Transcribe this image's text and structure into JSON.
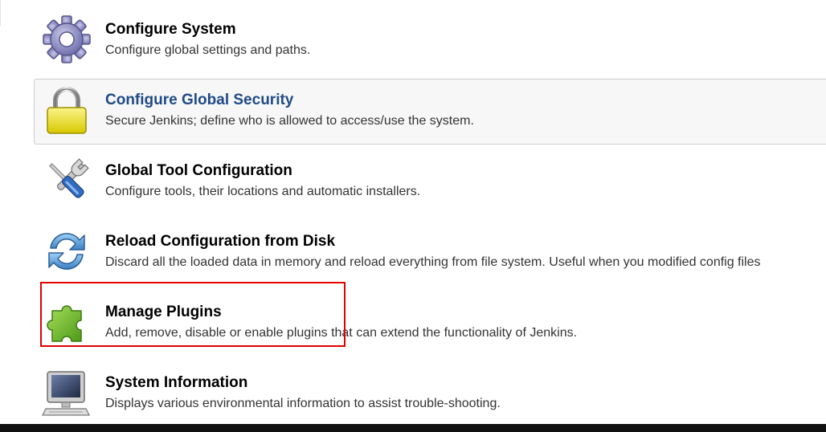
{
  "items": [
    {
      "title": "Configure System",
      "desc": "Configure global settings and paths.",
      "icon": "gear-icon"
    },
    {
      "title": "Configure Global Security",
      "desc": "Secure Jenkins; define who is allowed to access/use the system.",
      "icon": "lock-icon"
    },
    {
      "title": "Global Tool Configuration",
      "desc": "Configure tools, their locations and automatic installers.",
      "icon": "wrench-screwdriver-icon"
    },
    {
      "title": "Reload Configuration from Disk",
      "desc": "Discard all the loaded data in memory and reload everything from file system. Useful when you modified config files",
      "icon": "reload-icon"
    },
    {
      "title": "Manage Plugins",
      "desc": "Add, remove, disable or enable plugins that can extend the functionality of Jenkins.",
      "icon": "puzzle-piece-icon"
    },
    {
      "title": "System Information",
      "desc": "Displays various environmental information to assist trouble-shooting.",
      "icon": "computer-monitor-icon"
    }
  ],
  "colors": {
    "hover_title": "#204a87",
    "highlight_box": "#e00000"
  }
}
